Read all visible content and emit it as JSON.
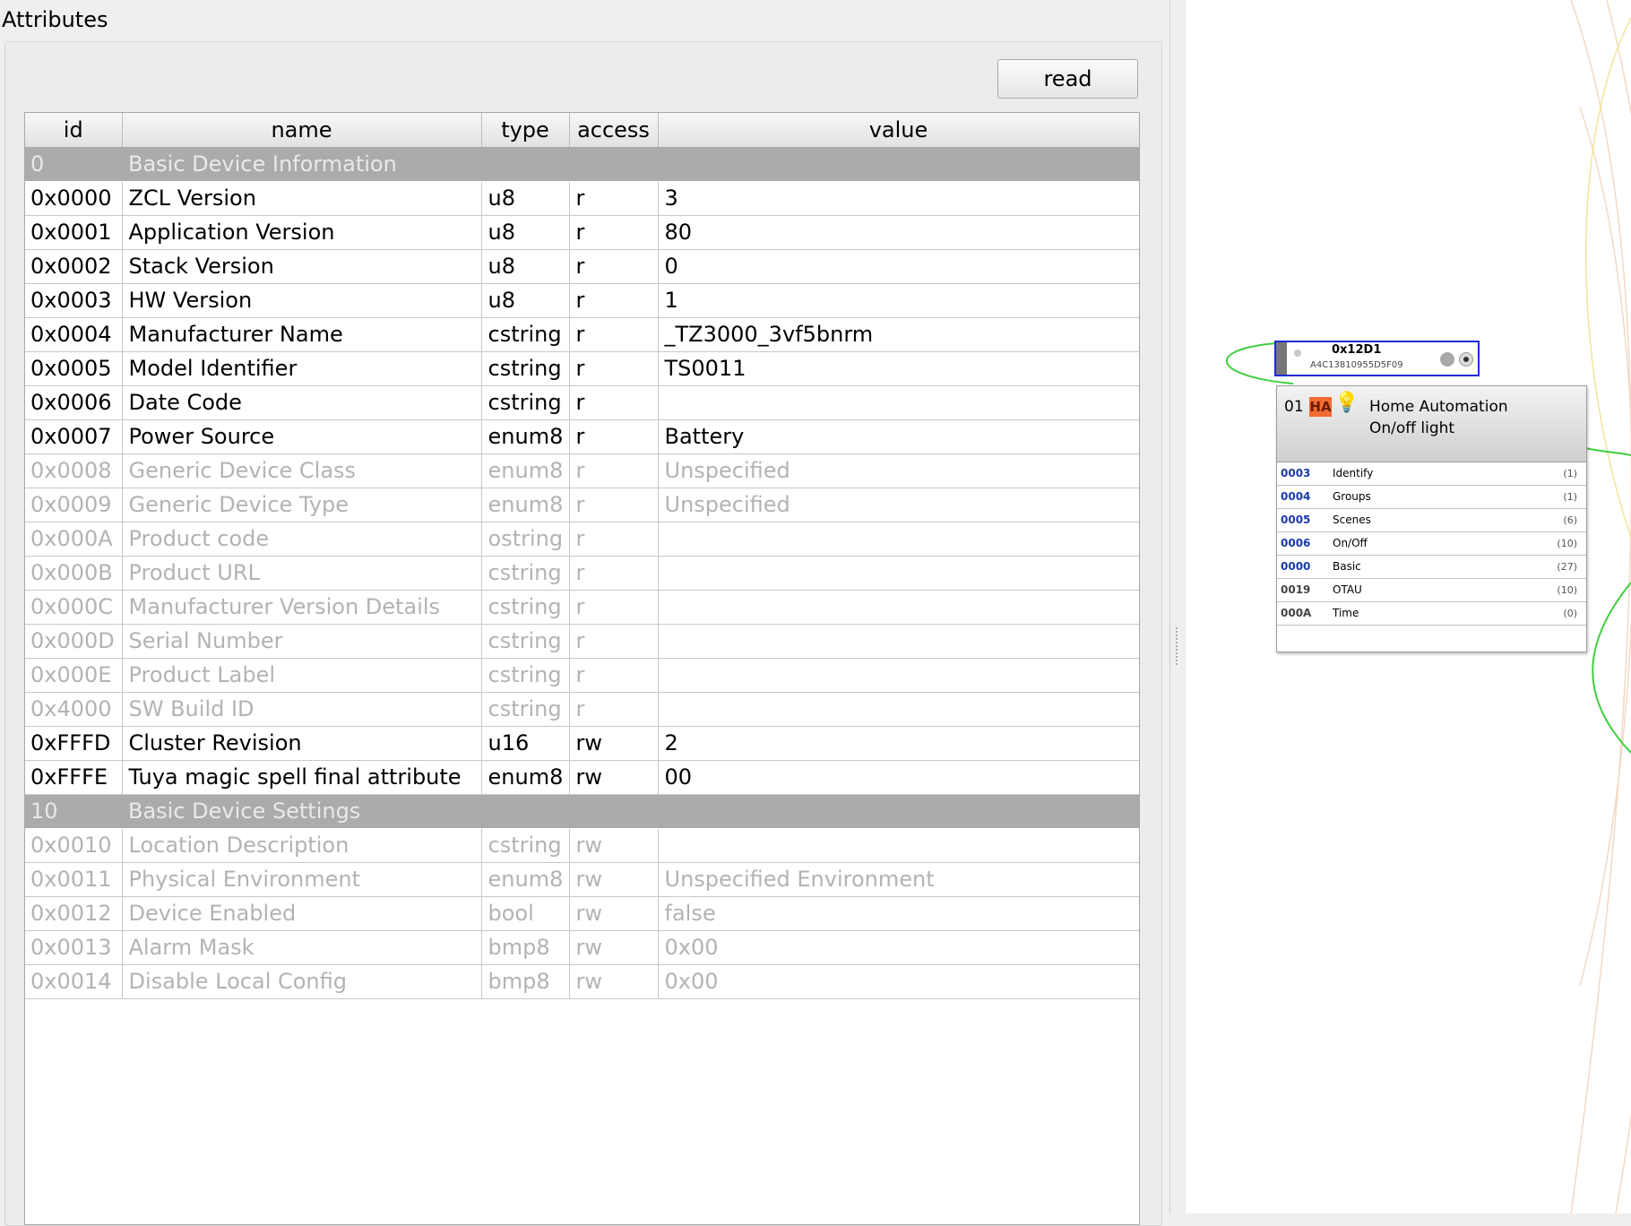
{
  "panel": {
    "title": "Attributes",
    "read_label": "read"
  },
  "table": {
    "columns": [
      "id",
      "name",
      "type",
      "access",
      "value"
    ],
    "rows": [
      {
        "id": "0",
        "name": "Basic Device Information",
        "type": "",
        "access": "",
        "value": "",
        "group": true,
        "dim": false
      },
      {
        "id": "0x0000",
        "name": "ZCL Version",
        "type": "u8",
        "access": "r",
        "value": "3",
        "group": false,
        "dim": false
      },
      {
        "id": "0x0001",
        "name": "Application Version",
        "type": "u8",
        "access": "r",
        "value": "80",
        "group": false,
        "dim": false
      },
      {
        "id": "0x0002",
        "name": "Stack Version",
        "type": "u8",
        "access": "r",
        "value": "0",
        "group": false,
        "dim": false
      },
      {
        "id": "0x0003",
        "name": "HW Version",
        "type": "u8",
        "access": "r",
        "value": "1",
        "group": false,
        "dim": false
      },
      {
        "id": "0x0004",
        "name": "Manufacturer Name",
        "type": "cstring",
        "access": "r",
        "value": "_TZ3000_3vf5bnrm",
        "group": false,
        "dim": false
      },
      {
        "id": "0x0005",
        "name": "Model Identifier",
        "type": "cstring",
        "access": "r",
        "value": "TS0011",
        "group": false,
        "dim": false
      },
      {
        "id": "0x0006",
        "name": "Date Code",
        "type": "cstring",
        "access": "r",
        "value": "",
        "group": false,
        "dim": false
      },
      {
        "id": "0x0007",
        "name": "Power Source",
        "type": "enum8",
        "access": "r",
        "value": "Battery",
        "group": false,
        "dim": false
      },
      {
        "id": "0x0008",
        "name": "Generic Device Class",
        "type": "enum8",
        "access": "r",
        "value": "Unspecified",
        "group": false,
        "dim": true
      },
      {
        "id": "0x0009",
        "name": "Generic Device Type",
        "type": "enum8",
        "access": "r",
        "value": "Unspecified",
        "group": false,
        "dim": true
      },
      {
        "id": "0x000A",
        "name": "Product code",
        "type": "ostring",
        "access": "r",
        "value": "",
        "group": false,
        "dim": true
      },
      {
        "id": "0x000B",
        "name": "Product URL",
        "type": "cstring",
        "access": "r",
        "value": "",
        "group": false,
        "dim": true
      },
      {
        "id": "0x000C",
        "name": "Manufacturer Version Details",
        "type": "cstring",
        "access": "r",
        "value": "",
        "group": false,
        "dim": true
      },
      {
        "id": "0x000D",
        "name": "Serial Number",
        "type": "cstring",
        "access": "r",
        "value": "",
        "group": false,
        "dim": true
      },
      {
        "id": "0x000E",
        "name": "Product Label",
        "type": "cstring",
        "access": "r",
        "value": "",
        "group": false,
        "dim": true
      },
      {
        "id": "0x4000",
        "name": "SW Build ID",
        "type": "cstring",
        "access": "r",
        "value": "",
        "group": false,
        "dim": true
      },
      {
        "id": "0xFFFD",
        "name": "Cluster Revision",
        "type": "u16",
        "access": "rw",
        "value": "2",
        "group": false,
        "dim": false
      },
      {
        "id": "0xFFFE",
        "name": "Tuya magic spell final attribute",
        "type": "enum8",
        "access": "rw",
        "value": "00",
        "group": false,
        "dim": false
      },
      {
        "id": "10",
        "name": "Basic Device Settings",
        "type": "",
        "access": "",
        "value": "",
        "group": true,
        "dim": false
      },
      {
        "id": "0x0010",
        "name": "Location Description",
        "type": "cstring",
        "access": "rw",
        "value": "",
        "group": false,
        "dim": true
      },
      {
        "id": "0x0011",
        "name": "Physical Environment",
        "type": "enum8",
        "access": "rw",
        "value": "Unspecified Environment",
        "group": false,
        "dim": true
      },
      {
        "id": "0x0012",
        "name": "Device Enabled",
        "type": "bool",
        "access": "rw",
        "value": "false",
        "group": false,
        "dim": true
      },
      {
        "id": "0x0013",
        "name": "Alarm Mask",
        "type": "bmp8",
        "access": "rw",
        "value": "0x00",
        "group": false,
        "dim": true
      },
      {
        "id": "0x0014",
        "name": "Disable Local Config",
        "type": "bmp8",
        "access": "rw",
        "value": "0x00",
        "group": false,
        "dim": true
      }
    ]
  },
  "node": {
    "nwk_address": "0x12D1",
    "mac_address": "A4C13810955D5F09",
    "endpoint": {
      "number": "01",
      "profile_badge": "HA",
      "profile": "Home Automation",
      "device": "On/off light",
      "icon": "lightbulb-icon",
      "clusters": [
        {
          "id": "0003",
          "name": "Identify",
          "count": "(1)",
          "server": true
        },
        {
          "id": "0004",
          "name": "Groups",
          "count": "(1)",
          "server": true
        },
        {
          "id": "0005",
          "name": "Scenes",
          "count": "(6)",
          "server": true
        },
        {
          "id": "0006",
          "name": "On/Off",
          "count": "(10)",
          "server": true
        },
        {
          "id": "0000",
          "name": "Basic",
          "count": "(27)",
          "server": true
        },
        {
          "id": "0019",
          "name": "OTAU",
          "count": "(10)",
          "server": false
        },
        {
          "id": "000A",
          "name": "Time",
          "count": "(0)",
          "server": false
        }
      ]
    }
  },
  "colors": {
    "group_row": "#ababab",
    "dim_text": "#b3b3b3",
    "node_selected_border": "#1f2bd8",
    "ha_badge": "#f26b32",
    "server_cluster_id": "#1a3ca6",
    "link_green": "#3fcf3f"
  }
}
